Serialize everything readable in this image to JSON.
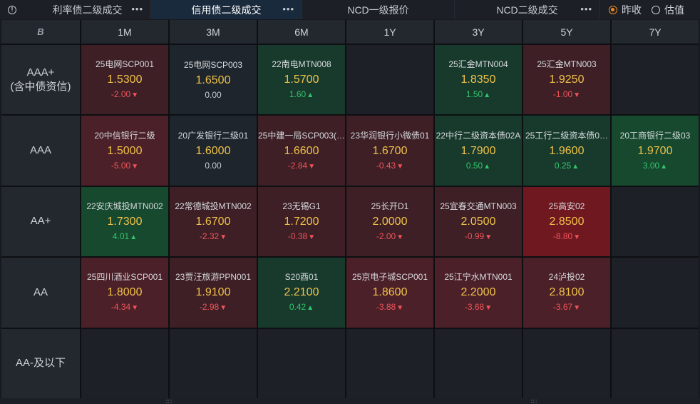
{
  "tabs": [
    {
      "label": "利率债二级成交",
      "active": false,
      "dots": "•••"
    },
    {
      "label": "信用债二级成交",
      "active": true,
      "dots": "•••"
    },
    {
      "label": "NCD一级报价",
      "active": false,
      "dots": ""
    },
    {
      "label": "NCD二级成交",
      "active": false,
      "dots": "•••"
    }
  ],
  "info_icon": "!",
  "radios": [
    {
      "label": "昨收",
      "selected": true
    },
    {
      "label": "估值",
      "selected": false
    }
  ],
  "corner_logo": "B",
  "columns": [
    "1M",
    "3M",
    "6M",
    "1Y",
    "3Y",
    "5Y",
    "7Y"
  ],
  "rows": [
    {
      "label": "AAA+\n(含中债资信)",
      "cells": [
        {
          "name": "25电网SCP001",
          "yield": "1.5300",
          "change": "-2.00",
          "dir": "down",
          "tone": "red-dark"
        },
        {
          "name": "25电网SCP003",
          "yield": "1.6500",
          "change": "0.00",
          "dir": "flat",
          "tone": "neutral"
        },
        {
          "name": "22南电MTN008",
          "yield": "1.5700",
          "change": "1.60",
          "dir": "up",
          "tone": "green-dark"
        },
        null,
        {
          "name": "25汇金MTN004",
          "yield": "1.8350",
          "change": "1.50",
          "dir": "up",
          "tone": "green-dark"
        },
        {
          "name": "25汇金MTN003",
          "yield": "1.9250",
          "change": "-1.00",
          "dir": "down",
          "tone": "red-dark"
        },
        null
      ]
    },
    {
      "label": "AAA",
      "cells": [
        {
          "name": "20中信银行二级",
          "yield": "1.5000",
          "change": "-5.00",
          "dir": "down",
          "tone": "red-mid"
        },
        {
          "name": "20广发银行二级01",
          "yield": "1.6000",
          "change": "0.00",
          "dir": "flat",
          "tone": "neutral"
        },
        {
          "name": "25中建一局SCP003(…",
          "yield": "1.6600",
          "change": "-2.84",
          "dir": "down",
          "tone": "red-dark"
        },
        {
          "name": "23华润银行小微债01",
          "yield": "1.6700",
          "change": "-0.43",
          "dir": "down",
          "tone": "red-dark"
        },
        {
          "name": "22中行二级资本债02A",
          "yield": "1.7900",
          "change": "0.50",
          "dir": "up",
          "tone": "green-dark"
        },
        {
          "name": "25工行二级资本债0…",
          "yield": "1.9600",
          "change": "0.25",
          "dir": "up",
          "tone": "green-dark"
        },
        {
          "name": "20工商银行二级03",
          "yield": "1.9700",
          "change": "3.00",
          "dir": "up",
          "tone": "green-mid"
        }
      ]
    },
    {
      "label": "AA+",
      "cells": [
        {
          "name": "22安庆城投MTN002",
          "yield": "1.7300",
          "change": "4.01",
          "dir": "up",
          "tone": "green-mid"
        },
        {
          "name": "22常德城投MTN002",
          "yield": "1.6700",
          "change": "-2.32",
          "dir": "down",
          "tone": "red-dark"
        },
        {
          "name": "23无锡G1",
          "yield": "1.7200",
          "change": "-0.38",
          "dir": "down",
          "tone": "red-dark"
        },
        {
          "name": "25长开D1",
          "yield": "2.0000",
          "change": "-2.00",
          "dir": "down",
          "tone": "red-dark"
        },
        {
          "name": "25宜春交通MTN003",
          "yield": "2.0500",
          "change": "-0.99",
          "dir": "down",
          "tone": "red-dark"
        },
        {
          "name": "25高安02",
          "yield": "2.8500",
          "change": "-8.80",
          "dir": "down",
          "tone": "red-bright"
        },
        null
      ]
    },
    {
      "label": "AA",
      "cells": [
        {
          "name": "25四川酒业SCP001",
          "yield": "1.8000",
          "change": "-4.34",
          "dir": "down",
          "tone": "red-mid"
        },
        {
          "name": "23贾汪旅游PPN001",
          "yield": "1.9100",
          "change": "-2.98",
          "dir": "down",
          "tone": "red-dark"
        },
        {
          "name": "S20酉01",
          "yield": "2.2100",
          "change": "0.42",
          "dir": "up",
          "tone": "green-dark"
        },
        {
          "name": "25京电子城SCP001",
          "yield": "1.8600",
          "change": "-3.88",
          "dir": "down",
          "tone": "red-mid"
        },
        {
          "name": "25江宁水MTN001",
          "yield": "2.2000",
          "change": "-3.68",
          "dir": "down",
          "tone": "red-mid"
        },
        {
          "name": "24泸投02",
          "yield": "2.8100",
          "change": "-3.67",
          "dir": "down",
          "tone": "red-mid"
        },
        null
      ]
    },
    {
      "label": "AA-及以下",
      "cells": [
        null,
        null,
        null,
        null,
        null,
        null,
        null
      ]
    }
  ],
  "arrows": {
    "up": "▲",
    "down": "▼"
  }
}
